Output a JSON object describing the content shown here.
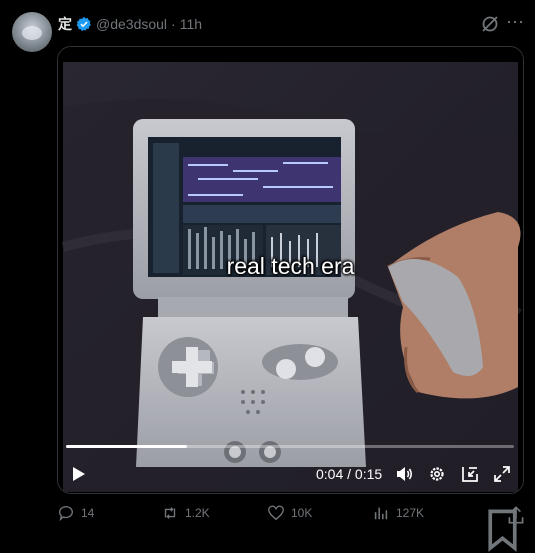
{
  "author": {
    "name": "定",
    "handle": "@de3dsoul",
    "separator": "·",
    "time": "11h",
    "verified": true
  },
  "video": {
    "caption": "real tech era",
    "current_time": "0:04",
    "duration": "0:15",
    "time_separator": " / ",
    "progress_fraction": 0.27
  },
  "actions": {
    "replies": "14",
    "reposts": "1.2K",
    "likes": "10K",
    "views": "127K"
  },
  "colors": {
    "accent": "#1d9bf0",
    "muted": "#71767b",
    "text": "#e7e9ea"
  }
}
